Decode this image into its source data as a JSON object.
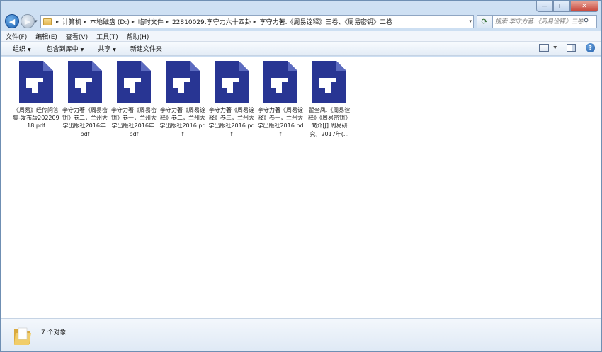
{
  "window": {
    "minimize_glyph": "—",
    "maximize_glyph": "▢",
    "close_glyph": "✕"
  },
  "address": {
    "crumbs": [
      "计算机",
      "本地磁盘 (D:)",
      "临时文件",
      "22810029.李守力六十四卦",
      "李守力著.《周易诠释》三卷、《周易密钥》二卷"
    ],
    "separator": "▸",
    "dropdown_glyph": "▾"
  },
  "search": {
    "placeholder": "搜索 李守力著.《周易诠释》三卷、《周..."
  },
  "menu": {
    "items": [
      "文件(F)",
      "编辑(E)",
      "查看(V)",
      "工具(T)",
      "帮助(H)"
    ]
  },
  "toolbar": {
    "organize": "组织",
    "include_library": "包含到库中",
    "share": "共享",
    "new_folder": "新建文件夹"
  },
  "files": [
    {
      "name": "《周易》经传问答集-发布版20220918.pdf"
    },
    {
      "name": "李守力著《周易密钥》卷二，兰州大学出版社2016年.pdf"
    },
    {
      "name": "李守力著《周易密钥》卷一，兰州大学出版社2016年.pdf"
    },
    {
      "name": "李守力著《周易诠释》卷二，兰州大学出版社2016.pdf"
    },
    {
      "name": "李守力著《周易诠释》卷三，兰州大学出版社2016.pdf"
    },
    {
      "name": "李守力著《周易诠释》卷一，兰州大学出版社2016.pdf"
    },
    {
      "name": "翟奎凤.《周易诠释》《周易密钥》简介[J].周易研究，2017年(..."
    }
  ],
  "status": {
    "count": "7 个对象"
  },
  "colors": {
    "pdf_icon": "#283593",
    "folder": "#e8c060"
  }
}
